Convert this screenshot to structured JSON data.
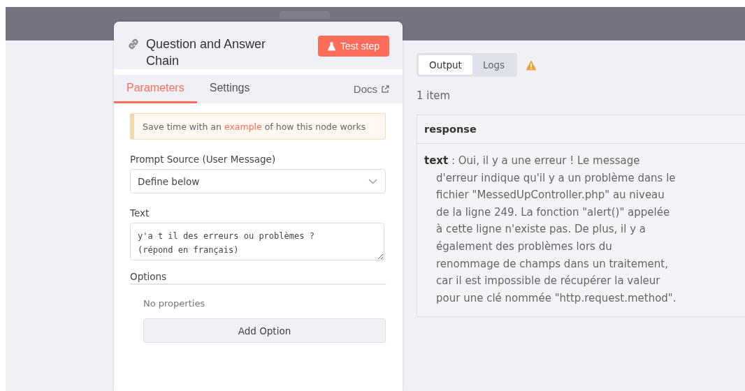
{
  "node_panel": {
    "title": "Question and Answer Chain",
    "test_button": "Test step",
    "tabs": [
      {
        "label": "Parameters",
        "selected": true
      },
      {
        "label": "Settings",
        "selected": false
      }
    ],
    "docs_link": "Docs",
    "hint": {
      "before": "Save time with an",
      "link": "example",
      "after": "of how this node works"
    },
    "prompt_source": {
      "label": "Prompt Source (User Message)",
      "value": "Define below"
    },
    "text_field": {
      "label": "Text",
      "value": "y'a t il des erreurs ou problèmes ?\n(répond en français)"
    },
    "options": {
      "title": "Options",
      "empty": "No properties",
      "add_button": "Add Option"
    }
  },
  "output_panel": {
    "tabs": [
      {
        "label": "Output",
        "selected": true
      },
      {
        "label": "Logs",
        "selected": false
      }
    ],
    "item_count": "1 item",
    "table": {
      "column": "response",
      "rows": [
        {
          "key": "text",
          "separator": ":",
          "value": "Oui, il y a une erreur ! Le message d'erreur indique qu'il y a un problème dans le fichier \"MessedUpController.php\" au niveau de la ligne 249. La fonction \"alert()\" appelée à cette ligne n'existe pas. De plus, il y a également des problèmes lors du renommage de champs dans un traitement, car il est impossible de récupérer la valeur pour une clé nommée \"http.request.method\"."
        }
      ]
    }
  }
}
